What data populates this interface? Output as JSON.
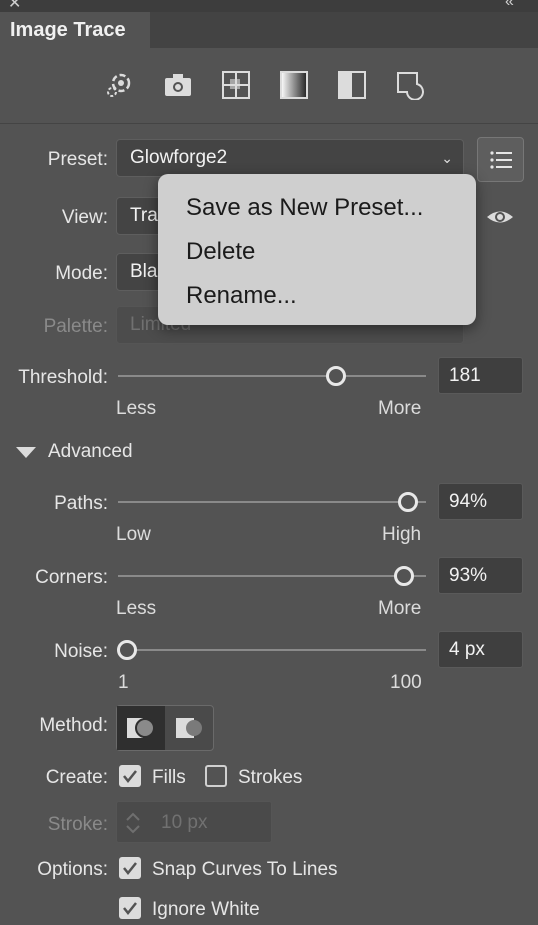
{
  "panel": {
    "tab_title": "Image Trace",
    "close_glyph": "✕",
    "collapse_glyph": "«"
  },
  "toolbar": {
    "icons": [
      "auto-color-icon",
      "high-color-icon",
      "low-color-icon",
      "grayscale-icon",
      "black-white-icon",
      "outline-icon"
    ]
  },
  "preset": {
    "label": "Preset:",
    "value": "Glowforge2"
  },
  "view": {
    "label": "View:",
    "value": "Tra"
  },
  "mode": {
    "label": "Mode:",
    "value": "Bla"
  },
  "palette": {
    "label": "Palette:",
    "value": "Limited"
  },
  "menu": {
    "items": [
      "Save as New Preset...",
      "Delete",
      "Rename..."
    ]
  },
  "threshold": {
    "label": "Threshold:",
    "value": "181",
    "min_label": "Less",
    "max_label": "More",
    "level": 181,
    "range": [
      1,
      255
    ]
  },
  "advanced": {
    "label": "Advanced"
  },
  "paths": {
    "label": "Paths:",
    "value": "94%",
    "min_label": "Low",
    "max_label": "High",
    "level": 94
  },
  "corners": {
    "label": "Corners:",
    "value": "93%",
    "min_label": "Less",
    "max_label": "More",
    "level": 93
  },
  "noise": {
    "label": "Noise:",
    "value": "4 px",
    "min_label": "1",
    "max_label": "100",
    "level": 4
  },
  "method": {
    "label": "Method:",
    "selected": "abutting"
  },
  "create": {
    "label": "Create:",
    "fills_label": "Fills",
    "fills_checked": true,
    "strokes_label": "Strokes",
    "strokes_checked": false
  },
  "stroke": {
    "label": "Stroke:",
    "value": "10 px"
  },
  "options": {
    "label": "Options:",
    "snap_label": "Snap Curves To Lines",
    "snap_checked": true,
    "ignore_white_label": "Ignore White",
    "ignore_white_checked": true
  }
}
